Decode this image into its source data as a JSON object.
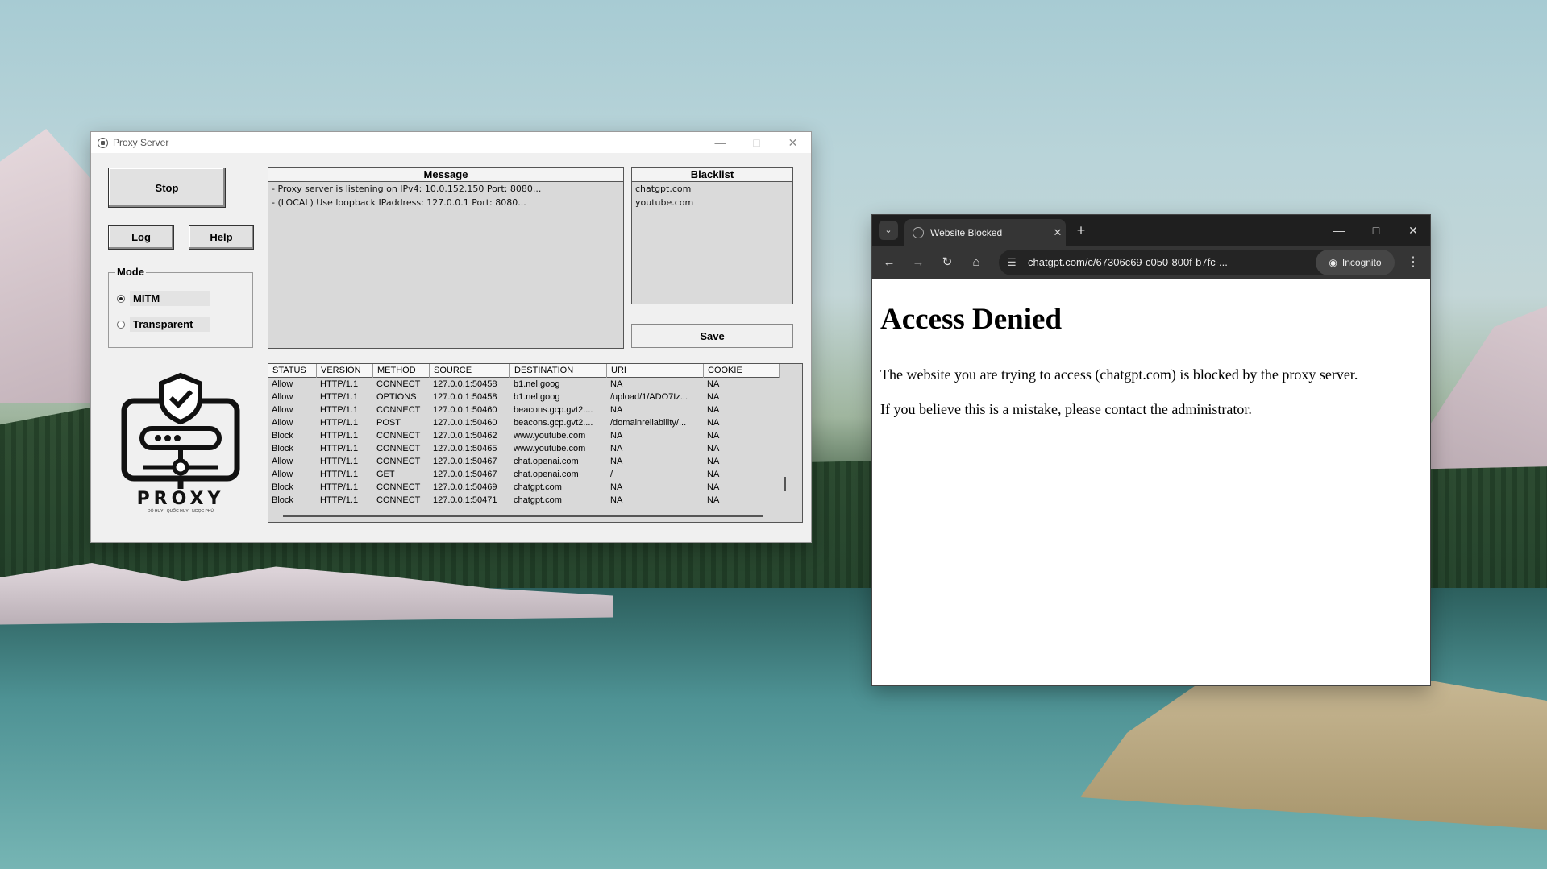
{
  "proxy_window": {
    "title": "Proxy Server",
    "stop_label": "Stop",
    "log_label": "Log",
    "help_label": "Help",
    "mode": {
      "label": "Mode",
      "options": [
        "MITM",
        "Transparent"
      ],
      "selected": "MITM"
    },
    "message": {
      "header": "Message",
      "lines": [
        "- Proxy server is listening on IPv4: 10.0.152.150 Port: 8080...",
        "- (LOCAL) Use loopback IPaddress: 127.0.0.1 Port: 8080..."
      ]
    },
    "blacklist": {
      "header": "Blacklist",
      "items": [
        "chatgpt.com",
        "youtube.com"
      ],
      "save_label": "Save"
    },
    "table": {
      "columns": [
        "STATUS",
        "VERSION",
        "METHOD",
        "SOURCE",
        "DESTINATION",
        "URI",
        "COOKIE"
      ],
      "rows": [
        [
          "Allow",
          "HTTP/1.1",
          "CONNECT",
          "127.0.0.1:50458",
          "b1.nel.goog",
          "NA",
          "NA"
        ],
        [
          "Allow",
          "HTTP/1.1",
          "OPTIONS",
          "127.0.0.1:50458",
          "b1.nel.goog",
          "/upload/1/ADO7Iz...",
          "NA"
        ],
        [
          "Allow",
          "HTTP/1.1",
          "CONNECT",
          "127.0.0.1:50460",
          "beacons.gcp.gvt2....",
          "NA",
          "NA"
        ],
        [
          "Allow",
          "HTTP/1.1",
          "POST",
          "127.0.0.1:50460",
          "beacons.gcp.gvt2....",
          "/domainreliability/...",
          "NA"
        ],
        [
          "Block",
          "HTTP/1.1",
          "CONNECT",
          "127.0.0.1:50462",
          "www.youtube.com",
          "NA",
          "NA"
        ],
        [
          "Block",
          "HTTP/1.1",
          "CONNECT",
          "127.0.0.1:50465",
          "www.youtube.com",
          "NA",
          "NA"
        ],
        [
          "Allow",
          "HTTP/1.1",
          "CONNECT",
          "127.0.0.1:50467",
          "chat.openai.com",
          "NA",
          "NA"
        ],
        [
          "Allow",
          "HTTP/1.1",
          "GET",
          "127.0.0.1:50467",
          "chat.openai.com",
          "/",
          "NA"
        ],
        [
          "Block",
          "HTTP/1.1",
          "CONNECT",
          "127.0.0.1:50469",
          "chatgpt.com",
          "NA",
          "NA"
        ],
        [
          "Block",
          "HTTP/1.1",
          "CONNECT",
          "127.0.0.1:50471",
          "chatgpt.com",
          "NA",
          "NA"
        ]
      ]
    },
    "logo": {
      "text": "PROXY",
      "subtitle": "ĐỖ HUY - QUỐC HUY - NGỌC PHÚ"
    }
  },
  "browser": {
    "tab_title": "Website Blocked",
    "url": "chatgpt.com/c/67306c69-c050-800f-b7fc-...",
    "incognito_label": "Incognito",
    "page": {
      "heading": "Access Denied",
      "paragraph1": "The website you are trying to access (chatgpt.com) is blocked by the proxy server.",
      "paragraph2": "If you believe this is a mistake, please contact the administrator."
    }
  }
}
